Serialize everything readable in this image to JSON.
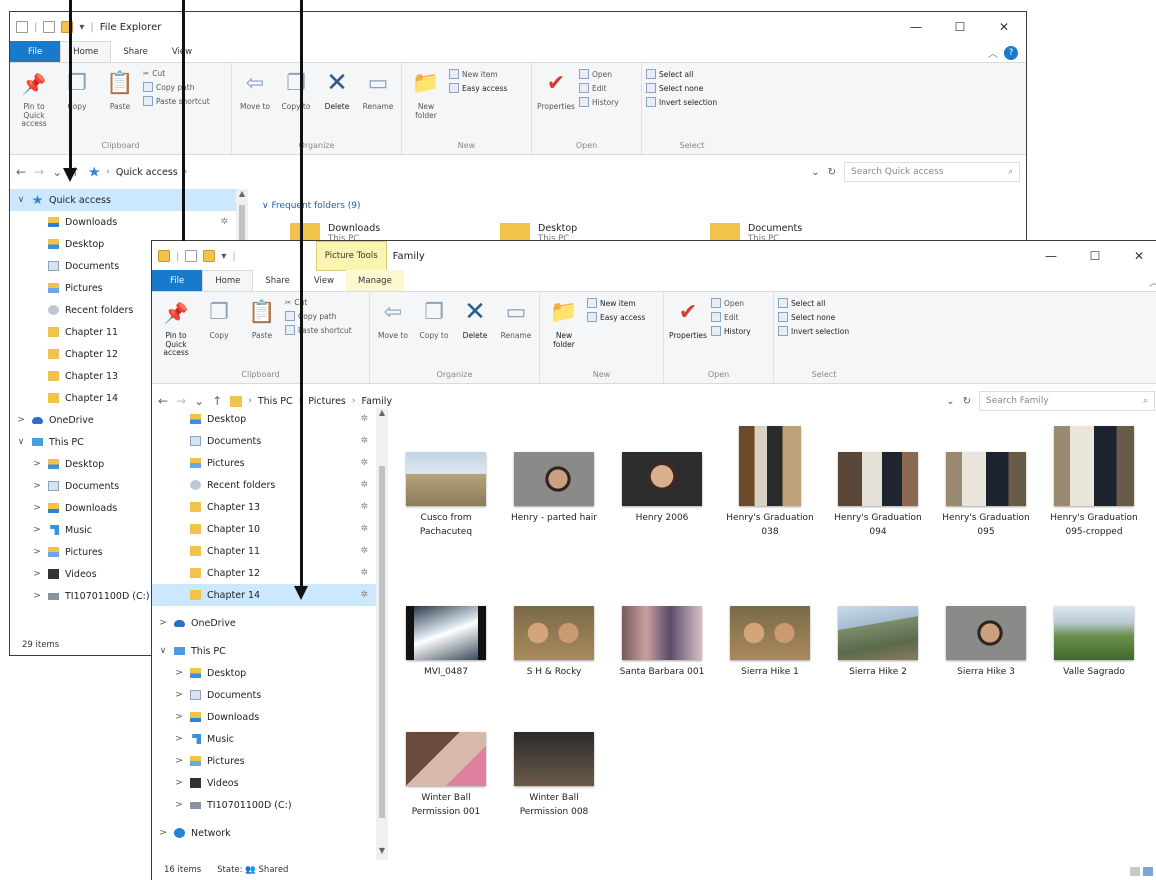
{
  "back": {
    "title": "File Explorer",
    "tabs": [
      "File",
      "Home",
      "Share",
      "View"
    ],
    "ribbon": {
      "clipboard": {
        "label": "Clipboard",
        "pin": "Pin to Quick access",
        "copy": "Copy",
        "paste": "Paste",
        "cut": "Cut",
        "copy_path": "Copy path",
        "paste_shortcut": "Paste shortcut"
      },
      "organize": {
        "label": "Organize",
        "move_to": "Move to",
        "copy_to": "Copy to",
        "delete": "Delete",
        "rename": "Rename"
      },
      "new": {
        "label": "New",
        "new_folder": "New folder",
        "new_item": "New item",
        "easy_access": "Easy access"
      },
      "open": {
        "label": "Open",
        "properties": "Properties",
        "open": "Open",
        "edit": "Edit",
        "history": "History"
      },
      "select": {
        "label": "Select",
        "select_all": "Select all",
        "select_none": "Select none",
        "invert": "Invert selection"
      }
    },
    "path": [
      "Quick access"
    ],
    "search_placeholder": "Search Quick access",
    "nav": [
      {
        "label": "Quick access",
        "icon": "star-icon",
        "sel": true,
        "exp": "∨",
        "level": 0
      },
      {
        "label": "Downloads",
        "icon": "down",
        "pin": true,
        "level": 1
      },
      {
        "label": "Desktop",
        "icon": "desk",
        "level": 1
      },
      {
        "label": "Documents",
        "icon": "doc",
        "level": 1
      },
      {
        "label": "Pictures",
        "icon": "pic",
        "level": 1
      },
      {
        "label": "Recent folders",
        "icon": "recent",
        "level": 1
      },
      {
        "label": "Chapter 11",
        "icon": "folder",
        "level": 1
      },
      {
        "label": "Chapter 12",
        "icon": "folder",
        "level": 1
      },
      {
        "label": "Chapter 13",
        "icon": "folder",
        "level": 1
      },
      {
        "label": "Chapter 14",
        "icon": "folder",
        "level": 1
      },
      {
        "label": "OneDrive",
        "icon": "cloud",
        "exp": ">",
        "level": 0
      },
      {
        "label": "This PC",
        "icon": "pc",
        "exp": "∨",
        "level": 0
      },
      {
        "label": "Desktop",
        "icon": "desk",
        "exp": ">",
        "level": 1
      },
      {
        "label": "Documents",
        "icon": "doc",
        "exp": ">",
        "level": 1
      },
      {
        "label": "Downloads",
        "icon": "down",
        "exp": ">",
        "level": 1
      },
      {
        "label": "Music",
        "icon": "music",
        "exp": ">",
        "level": 1
      },
      {
        "label": "Pictures",
        "icon": "pic",
        "exp": ">",
        "level": 1
      },
      {
        "label": "Videos",
        "icon": "video",
        "exp": ">",
        "level": 1
      },
      {
        "label": "TI10701100D (C:)",
        "icon": "drive",
        "exp": ">",
        "level": 1
      }
    ],
    "status": "29 items",
    "frequent_header": "Frequent folders (9)",
    "frequent": [
      {
        "name": "Downloads",
        "sub": "This PC"
      },
      {
        "name": "Desktop",
        "sub": "This PC"
      },
      {
        "name": "Documents",
        "sub": "This PC"
      }
    ]
  },
  "front": {
    "title": "Family",
    "context_tab": "Picture Tools",
    "tabs": [
      "File",
      "Home",
      "Share",
      "View",
      "Manage"
    ],
    "path": [
      "This PC",
      "Pictures",
      "Family"
    ],
    "search_placeholder": "Search Family",
    "nav": [
      {
        "label": "Desktop",
        "icon": "desk",
        "pin": true,
        "level": 1
      },
      {
        "label": "Documents",
        "icon": "doc",
        "pin": true,
        "level": 1
      },
      {
        "label": "Pictures",
        "icon": "pic",
        "pin": true,
        "level": 1
      },
      {
        "label": "Recent folders",
        "icon": "recent",
        "pin": true,
        "level": 1
      },
      {
        "label": "Chapter 13",
        "icon": "folder",
        "pin": true,
        "level": 1
      },
      {
        "label": "Chapter 10",
        "icon": "folder",
        "pin": true,
        "level": 1
      },
      {
        "label": "Chapter 11",
        "icon": "folder",
        "pin": true,
        "level": 1
      },
      {
        "label": "Chapter 12",
        "icon": "folder",
        "pin": true,
        "level": 1
      },
      {
        "label": "Chapter 14",
        "icon": "folder",
        "pin": true,
        "sel": true,
        "level": 1
      },
      {
        "label": "OneDrive",
        "icon": "cloud",
        "exp": ">",
        "level": 0,
        "gap": true
      },
      {
        "label": "This PC",
        "icon": "pc",
        "exp": "∨",
        "level": 0,
        "gap": true
      },
      {
        "label": "Desktop",
        "icon": "desk",
        "exp": ">",
        "level": 1
      },
      {
        "label": "Documents",
        "icon": "doc",
        "exp": ">",
        "level": 1
      },
      {
        "label": "Downloads",
        "icon": "down",
        "exp": ">",
        "level": 1
      },
      {
        "label": "Music",
        "icon": "music",
        "exp": ">",
        "level": 1
      },
      {
        "label": "Pictures",
        "icon": "pic",
        "exp": ">",
        "level": 1
      },
      {
        "label": "Videos",
        "icon": "video",
        "exp": ">",
        "level": 1
      },
      {
        "label": "TI10701100D (C:)",
        "icon": "drive",
        "exp": ">",
        "level": 1
      },
      {
        "label": "Network",
        "icon": "net",
        "exp": ">",
        "level": 0,
        "gap": true
      }
    ],
    "status_items": "16 items",
    "status_state_label": "State:",
    "status_state_value": "Shared",
    "files": [
      {
        "name": "Cusco from Pachacuteq",
        "style": "t-landscape",
        "shape": "wide"
      },
      {
        "name": "Henry - parted hair",
        "style": "t-faceroom",
        "shape": "wide"
      },
      {
        "name": "Henry 2006",
        "style": "t-face",
        "shape": "wide"
      },
      {
        "name": "Henry's Graduation 038",
        "style": "t-grad",
        "shape": "tall"
      },
      {
        "name": "Henry's Graduation 094",
        "style": "t-grad2",
        "shape": "wide"
      },
      {
        "name": "Henry's Graduation 095",
        "style": "t-grad3",
        "shape": "wide"
      },
      {
        "name": "Henry's Graduation 095-cropped",
        "style": "t-grad3",
        "shape": "tallwide"
      },
      {
        "name": "MVI_0487",
        "style": "filmstrip",
        "shape": "wide"
      },
      {
        "name": "S H & Rocky",
        "style": "t-kids",
        "shape": "wide"
      },
      {
        "name": "Santa Barbara 001",
        "style": "t-group",
        "shape": "wide"
      },
      {
        "name": "Sierra Hike 1",
        "style": "t-kids",
        "shape": "wide"
      },
      {
        "name": "Sierra Hike 2",
        "style": "t-mountain",
        "shape": "wide"
      },
      {
        "name": "Sierra Hike 3",
        "style": "t-faceroom",
        "shape": "wide"
      },
      {
        "name": "Valle Sagrado",
        "style": "t-valley",
        "shape": "wide"
      },
      {
        "name": "Winter Ball Permission 001",
        "style": "t-winter",
        "shape": "wide"
      },
      {
        "name": "Winter Ball Permission 008",
        "style": "t-dark",
        "shape": "wide"
      }
    ]
  }
}
